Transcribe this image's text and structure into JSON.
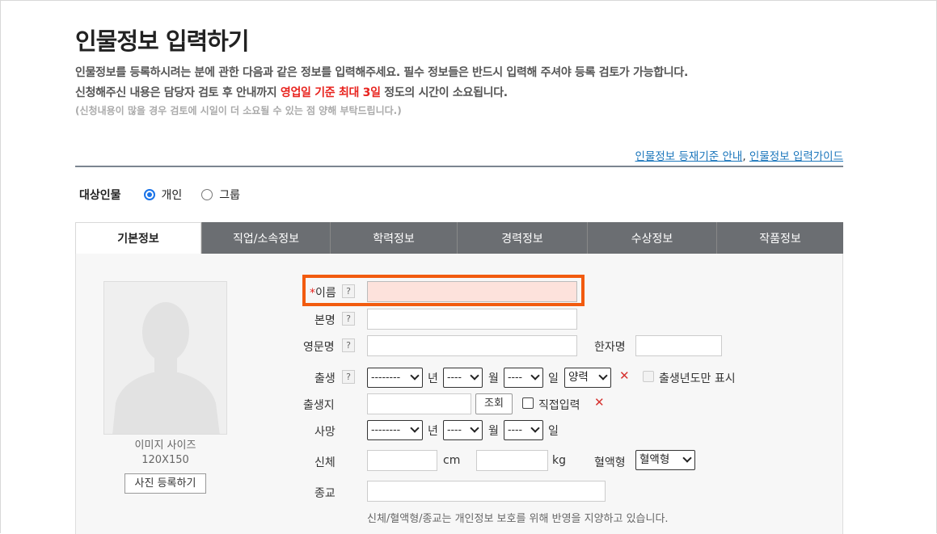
{
  "header": {
    "title": "인물정보 입력하기",
    "desc1": "인물정보를 등록하시려는 분에 관한 다음과 같은 정보를 입력해주세요. 필수 정보들은 반드시 입력해 주셔야 등록 검토가 가능합니다.",
    "desc2_a": "신청해주신 내용은 담당자 검토 후 안내까지 ",
    "desc2_red": "영업일 기준 최대 3일",
    "desc2_b": " 정도의 시간이 소요됩니다.",
    "desc3": "(신청내용이 많을 경우 검토에 시일이 더 소요될 수 있는 점 양해 부탁드립니다.)",
    "guide_link1": "인물정보 등재기준 안내",
    "guide_sep": ", ",
    "guide_link2": "인물정보 입력가이드"
  },
  "target": {
    "label": "대상인물",
    "options": [
      "개인",
      "그룹"
    ],
    "selected": "개인"
  },
  "tabs": [
    "기본정보",
    "직업/소속정보",
    "학력정보",
    "경력정보",
    "수상정보",
    "작품정보"
  ],
  "photo": {
    "size_label": "이미지 사이즈",
    "size_value": "120X150",
    "button": "사진 등록하기"
  },
  "form": {
    "required_mark": "*",
    "help": "?",
    "name_label": "이름",
    "realname_label": "본명",
    "english_label": "영문명",
    "hanja_label": "한자명",
    "birth_label": "출생",
    "birthplace_label": "출생지",
    "death_label": "사망",
    "body_label": "신체",
    "blood_label": "혈액형",
    "religion_label": "종교",
    "year_placeholder": "--------",
    "month_placeholder": "----",
    "day_placeholder": "----",
    "year_unit": "년",
    "month_unit": "월",
    "day_unit": "일",
    "calendar_value": "양력",
    "birth_year_only": "출생년도만 표시",
    "lookup_button": "조회",
    "direct_input": "직접입력",
    "cm": "cm",
    "kg": "kg",
    "blood_value": "혈액형",
    "delete_mark": "✕",
    "privacy_notice": "신체/혈액형/종교는 개인정보 보호를 위해 반영을 지양하고 있습니다."
  },
  "colors": {
    "accent_red": "#e8231e",
    "highlight_orange": "#f25b0f",
    "link_blue": "#1a75bb",
    "tab_gray": "#6b6e72"
  }
}
